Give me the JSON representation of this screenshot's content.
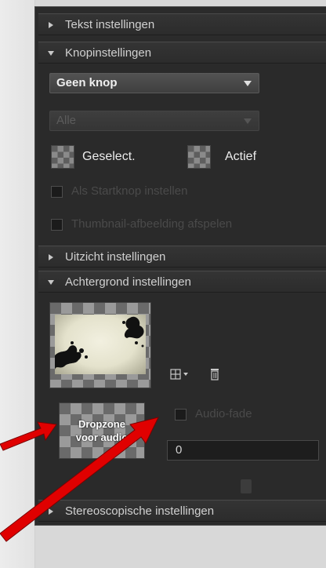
{
  "sections": {
    "text_settings": "Tekst instellingen",
    "button_settings": "Knopinstellingen",
    "view_settings": "Uitzicht instellingen",
    "background_settings": "Achtergrond instellingen",
    "stereo_settings": "Stereoscopische instellingen"
  },
  "button_panel": {
    "button_type_value": "Geen knop",
    "secondary_dropdown_value": "Alle",
    "selected_label": "Geselect.",
    "active_label": "Actief",
    "checkbox1_label": "Als Startknop instellen",
    "checkbox2_label": "Thumbnail-afbeelding afspelen"
  },
  "background_panel": {
    "dropzone_label_line1": "Dropzone",
    "dropzone_label_line2": "voor audio",
    "audio_checkbox_label": "Audio-fade",
    "number_value": "0"
  },
  "colors": {
    "panel_bg": "#2b2b2b",
    "annotation_arrow": "#e00000"
  }
}
